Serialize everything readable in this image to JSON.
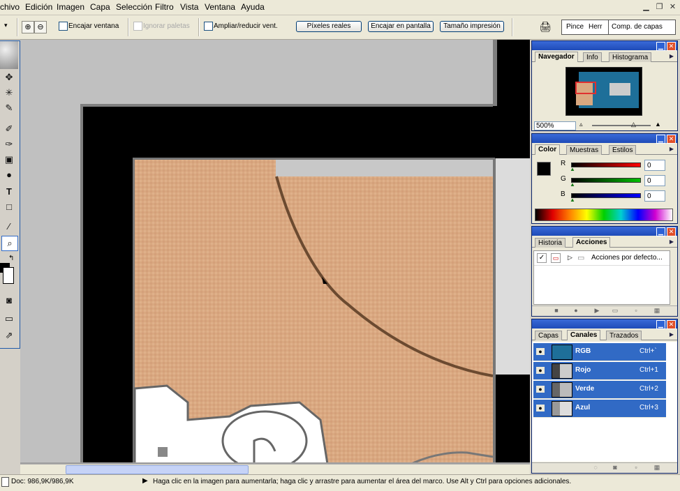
{
  "menu": {
    "items": [
      "chivo",
      "Edición",
      "Imagen",
      "Capa",
      "Selección",
      "Filtro",
      "Vista",
      "Ventana",
      "Ayuda"
    ]
  },
  "options": {
    "encajar_ventana": "Encajar ventana",
    "ignorar_paletas": "Ignorar paletas",
    "ampliar_reducir": "Ampliar/reducir vent.",
    "pixeles_reales": "Píxeles reales",
    "encajar_pantalla": "Encajar en pantalla",
    "tamano_impresion": "Tamaño impresión",
    "well_tabs": [
      "Pince",
      "Herr",
      "Comp. de capas"
    ]
  },
  "navigator": {
    "tabs": [
      "Navegador",
      "Info",
      "Histograma"
    ],
    "zoom": "500%"
  },
  "color": {
    "tabs": [
      "Color",
      "Muestras",
      "Estilos"
    ],
    "sliders": [
      {
        "label": "R",
        "value": "0",
        "gradient": "#ff0000"
      },
      {
        "label": "G",
        "value": "0",
        "gradient": "#00c000"
      },
      {
        "label": "B",
        "value": "0",
        "gradient": "#0000ff"
      }
    ]
  },
  "actions": {
    "tabs": [
      "Historia",
      "Acciones"
    ],
    "item": "Acciones por defecto..."
  },
  "channels": {
    "tabs": [
      "Capas",
      "Canales",
      "Trazados"
    ],
    "rows": [
      {
        "name": "RGB",
        "shortcut": "Ctrl+`"
      },
      {
        "name": "Rojo",
        "shortcut": "Ctrl+1"
      },
      {
        "name": "Verde",
        "shortcut": "Ctrl+2"
      },
      {
        "name": "Azul",
        "shortcut": "Ctrl+3"
      }
    ]
  },
  "status": {
    "doc": "Doc: 986,9K/986,9K",
    "hint": "Haga clic en la imagen para aumentarla; haga clic y arrastre para aumentar el área del marco. Use Alt y Ctrl para opciones adicionales."
  },
  "colors": {
    "accent": "#316ac5",
    "skin": "#d9a880",
    "title_bar": "#1e4bb8"
  }
}
